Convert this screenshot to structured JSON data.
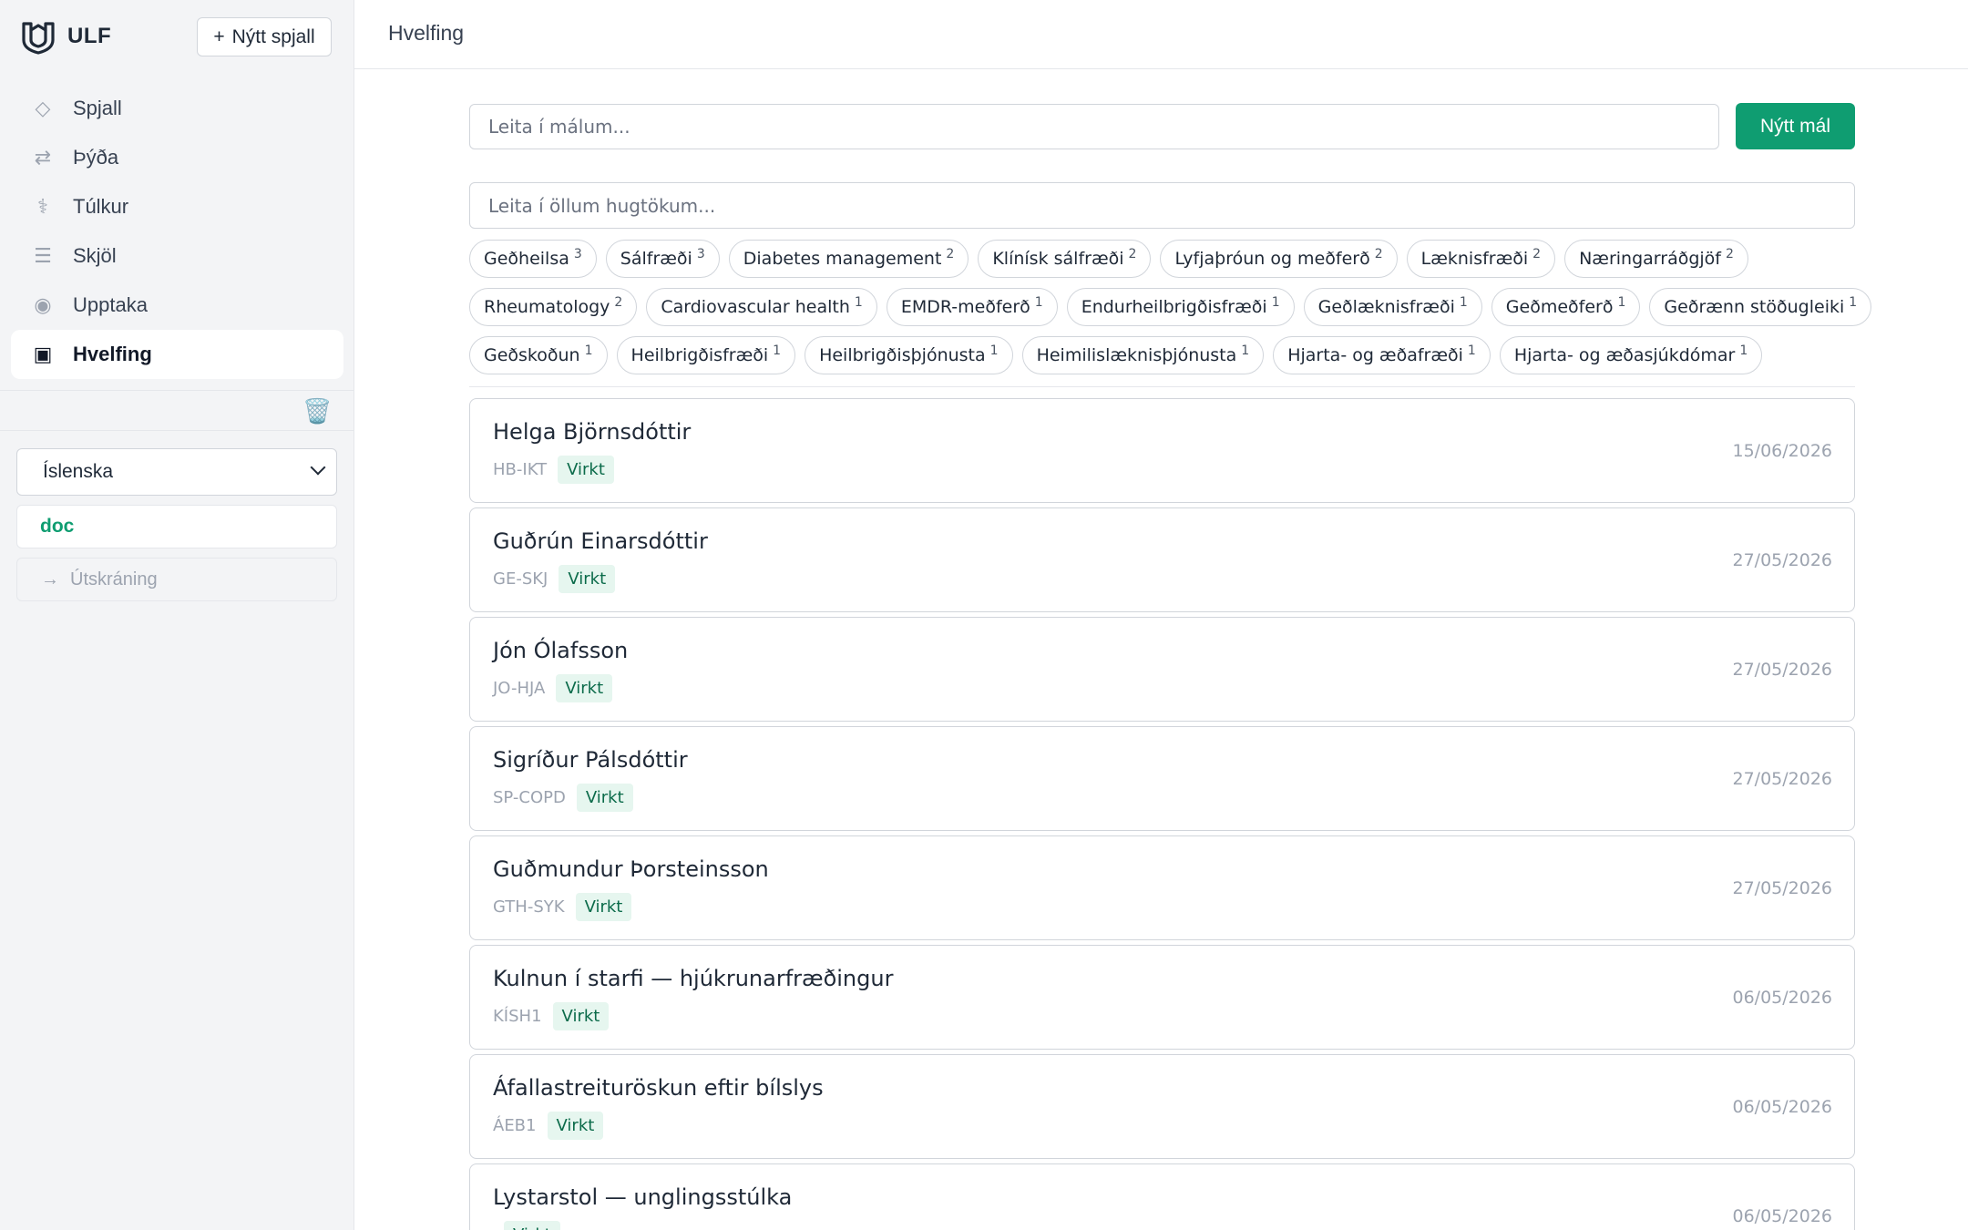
{
  "brand": {
    "name": "ULF"
  },
  "sidebar": {
    "new_chat_label": "Nýtt spjall",
    "items": [
      {
        "label": "Spjall",
        "icon": "◇",
        "active": false
      },
      {
        "label": "Þýða",
        "icon": "⇄",
        "active": false
      },
      {
        "label": "Túlkur",
        "icon": "⚕",
        "active": false
      },
      {
        "label": "Skjöl",
        "icon": "☰",
        "active": false
      },
      {
        "label": "Upptaka",
        "icon": "◉",
        "active": false
      },
      {
        "label": "Hvelfing",
        "icon": "▣",
        "active": true
      }
    ],
    "language": "Íslenska",
    "user": "doc",
    "logout_label": "Útskráning"
  },
  "header": {
    "title": "Hvelfing"
  },
  "search": {
    "cases_placeholder": "Leita í málum...",
    "new_case_label": "Nýtt mál",
    "concepts_placeholder": "Leita í öllum hugtökum..."
  },
  "chips": [
    {
      "label": "Geðheilsa",
      "count": "3"
    },
    {
      "label": "Sálfræði",
      "count": "3"
    },
    {
      "label": "Diabetes management",
      "count": "2"
    },
    {
      "label": "Klínísk sálfræði",
      "count": "2"
    },
    {
      "label": "Lyfjaþróun og meðferð",
      "count": "2"
    },
    {
      "label": "Læknisfræði",
      "count": "2"
    },
    {
      "label": "Næringarráðgjöf",
      "count": "2"
    },
    {
      "label": "Rheumatology",
      "count": "2"
    },
    {
      "label": "Cardiovascular health",
      "count": "1"
    },
    {
      "label": "EMDR-meðferð",
      "count": "1"
    },
    {
      "label": "Endurheilbrigðisfræði",
      "count": "1"
    },
    {
      "label": "Geðlæknisfræði",
      "count": "1"
    },
    {
      "label": "Geðmeðferð",
      "count": "1"
    },
    {
      "label": "Geðrænn stöðugleiki",
      "count": "1"
    },
    {
      "label": "Geðskoðun",
      "count": "1"
    },
    {
      "label": "Heilbrigðisfræði",
      "count": "1"
    },
    {
      "label": "Heilbrigðisþjónusta",
      "count": "1"
    },
    {
      "label": "Heimilislæknisþjónusta",
      "count": "1"
    },
    {
      "label": "Hjarta- og æðafræði",
      "count": "1"
    },
    {
      "label": "Hjarta- og æðasjúkdómar",
      "count": "1"
    }
  ],
  "cases": [
    {
      "name": "Helga Björnsdóttir",
      "code": "HB-IKT",
      "status": "Virkt",
      "date": "15/06/2026"
    },
    {
      "name": "Guðrún Einarsdóttir",
      "code": "GE-SKJ",
      "status": "Virkt",
      "date": "27/05/2026"
    },
    {
      "name": "Jón Ólafsson",
      "code": "JO-HJA",
      "status": "Virkt",
      "date": "27/05/2026"
    },
    {
      "name": "Sigríður Pálsdóttir",
      "code": "SP-COPD",
      "status": "Virkt",
      "date": "27/05/2026"
    },
    {
      "name": "Guðmundur Þorsteinsson",
      "code": "GTH-SYK",
      "status": "Virkt",
      "date": "27/05/2026"
    },
    {
      "name": "Kulnun í starfi — hjúkrunarfræðingur",
      "code": "KÍSH1",
      "status": "Virkt",
      "date": "06/05/2026"
    },
    {
      "name": "Áfallastreituröskun eftir bílslys",
      "code": "ÁEB1",
      "status": "Virkt",
      "date": "06/05/2026"
    },
    {
      "name": "Lystarstol — unglingsstúlka",
      "code": "",
      "status": "Virkt",
      "date": "06/05/2026"
    }
  ]
}
